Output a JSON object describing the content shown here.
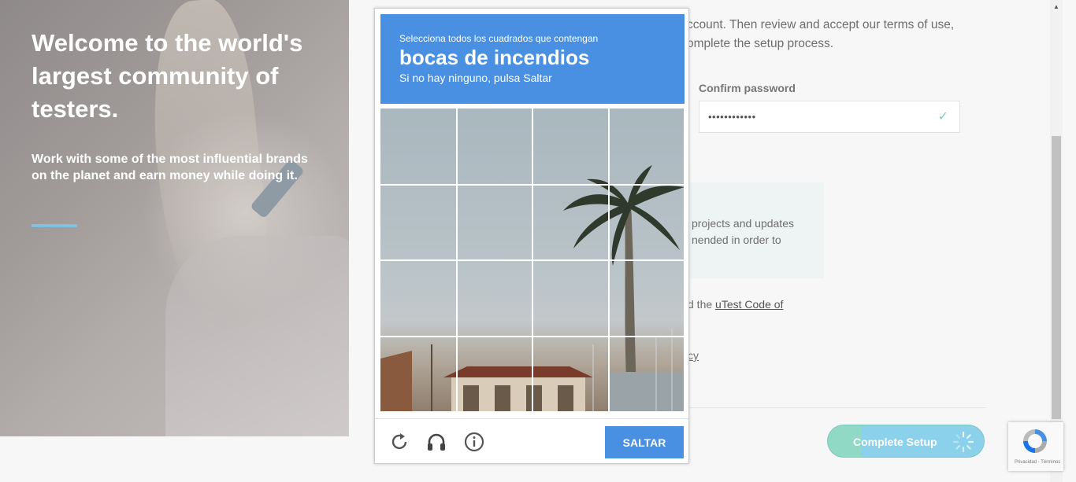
{
  "hero": {
    "title": "Welcome to the world's largest community of testers.",
    "subtitle": "Work with some of the most influential brands on the planet and earn money while doing it."
  },
  "form": {
    "intro_line1": "ccount. Then review and accept our terms of use,",
    "intro_line2": "omplete the setup process.",
    "confirm_label": "Confirm password",
    "confirm_value": "••••••••••••",
    "info_line1": "projects and updates",
    "info_line2": "nended in order to",
    "agree_prefix": "d the ",
    "agree_link": "uTest Code of",
    "policy_link": "cy",
    "submit_label": "Complete Setup"
  },
  "captcha": {
    "instruction": "Selecciona todos los cuadrados que contengan",
    "target": "bocas de incendios",
    "hint": "Si no hay ninguno, pulsa Saltar",
    "skip_label": "SALTAR",
    "grid_rows": 4,
    "grid_cols": 4
  },
  "recaptcha_badge": {
    "privacy_text": "Privacidad - Términos"
  },
  "colors": {
    "captcha_blue": "#4a90e2",
    "accent_line": "#7ec3de",
    "submit_green": "#8fd9c5",
    "submit_blue": "#8bd1ec"
  },
  "icons": {
    "reload": "reload-icon",
    "audio": "headphones-icon",
    "info": "info-icon",
    "check": "check-icon"
  }
}
